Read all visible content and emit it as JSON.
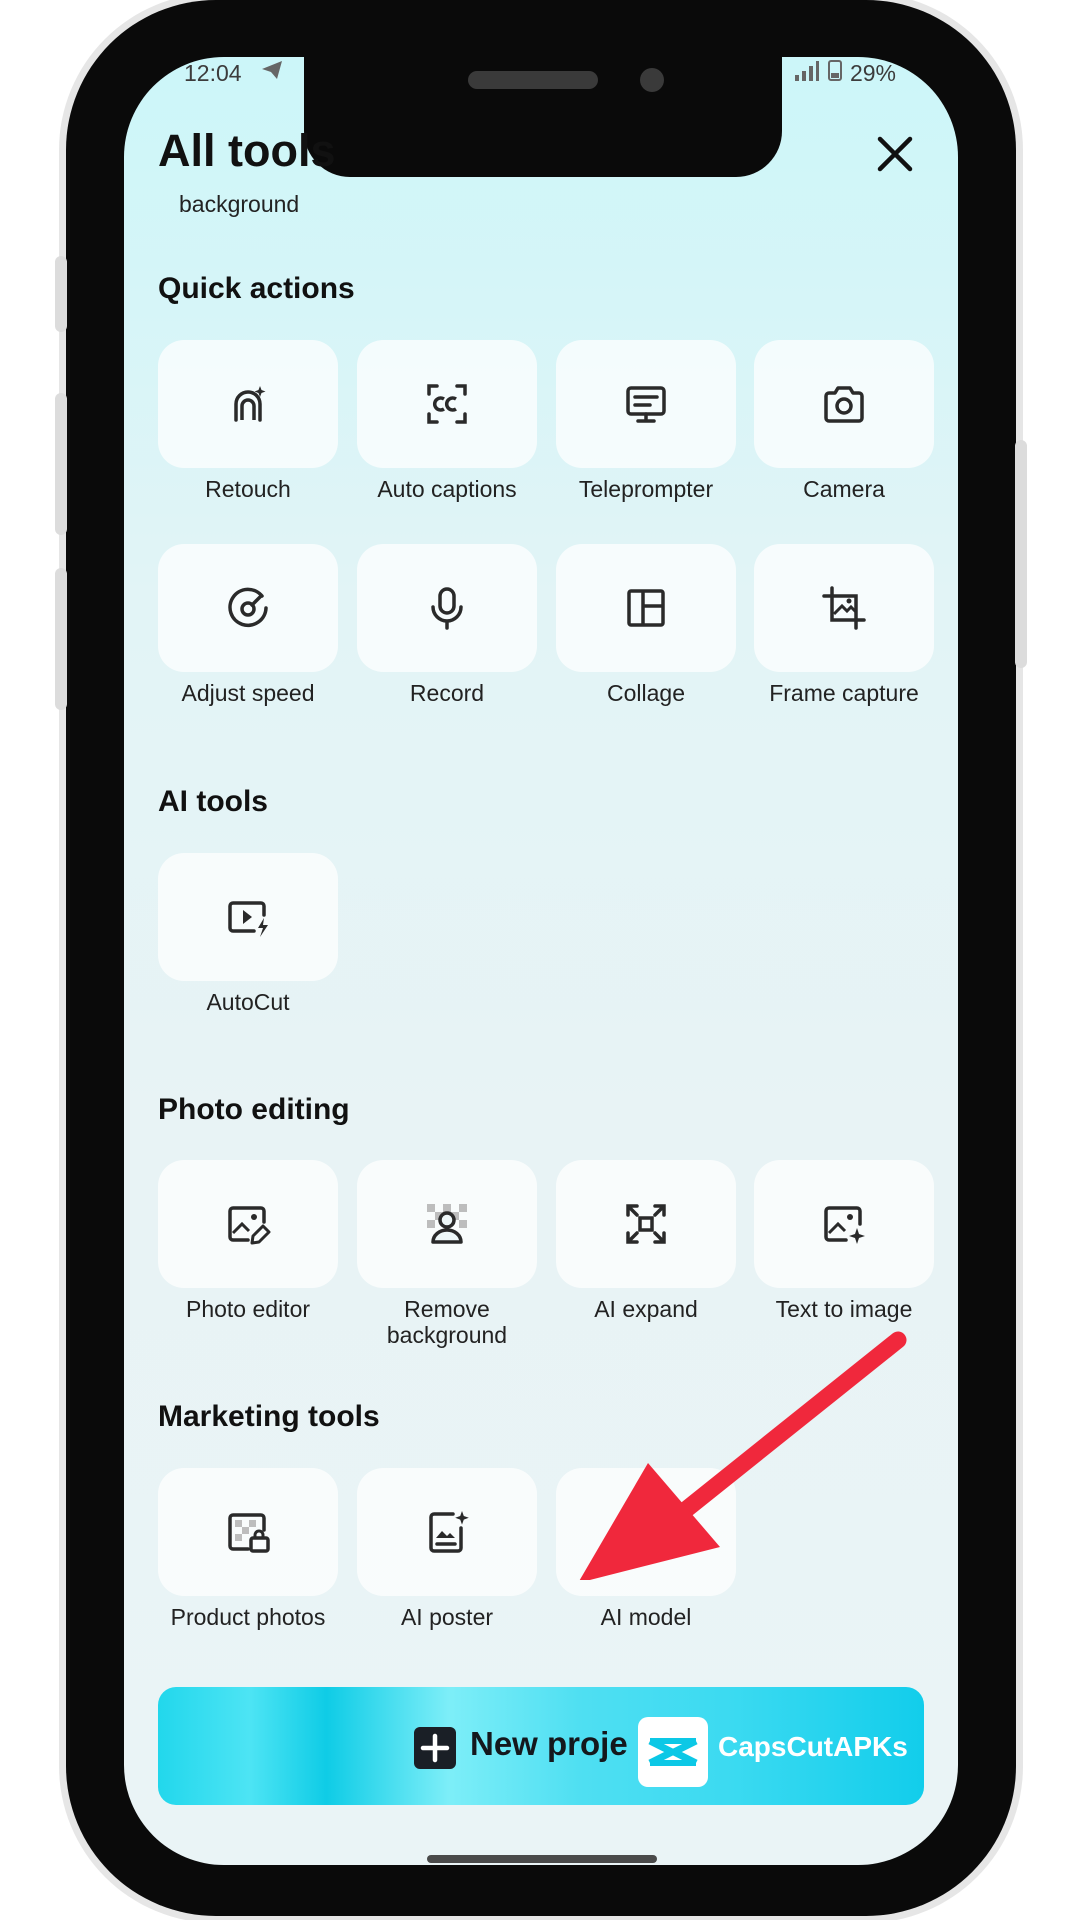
{
  "status_bar": {
    "time": "12:04",
    "battery": "29%"
  },
  "header": {
    "title": "All tools",
    "subtitle": "background"
  },
  "sections": [
    {
      "title": "Quick actions",
      "items": [
        {
          "label": "Retouch",
          "icon": "retouch-icon"
        },
        {
          "label": "Auto captions",
          "icon": "captions-icon"
        },
        {
          "label": "Teleprompter",
          "icon": "teleprompter-icon"
        },
        {
          "label": "Camera",
          "icon": "camera-icon"
        },
        {
          "label": "Adjust speed",
          "icon": "speed-icon"
        },
        {
          "label": "Record",
          "icon": "microphone-icon"
        },
        {
          "label": "Collage",
          "icon": "collage-icon"
        },
        {
          "label": "Frame capture",
          "icon": "crop-icon"
        }
      ]
    },
    {
      "title": "AI tools",
      "items": [
        {
          "label": "AutoCut",
          "icon": "autocut-icon"
        }
      ]
    },
    {
      "title": "Photo editing",
      "items": [
        {
          "label": "Photo editor",
          "icon": "photo-edit-icon"
        },
        {
          "label": "Remove background",
          "icon": "remove-background-icon"
        },
        {
          "label": "AI expand",
          "icon": "expand-icon"
        },
        {
          "label": "Text to image",
          "icon": "text-to-image-icon"
        }
      ]
    },
    {
      "title": "Marketing tools",
      "items": [
        {
          "label": "Product photos",
          "icon": "product-photos-icon"
        },
        {
          "label": "AI poster",
          "icon": "poster-icon"
        },
        {
          "label": "AI model",
          "icon": "shirt-icon"
        }
      ]
    }
  ],
  "new_project": {
    "label": "New proje"
  },
  "watermark": {
    "text": "CapsCutAPKs"
  },
  "colors": {
    "accent": "#1fd3ea",
    "arrow": "#f0283c"
  }
}
